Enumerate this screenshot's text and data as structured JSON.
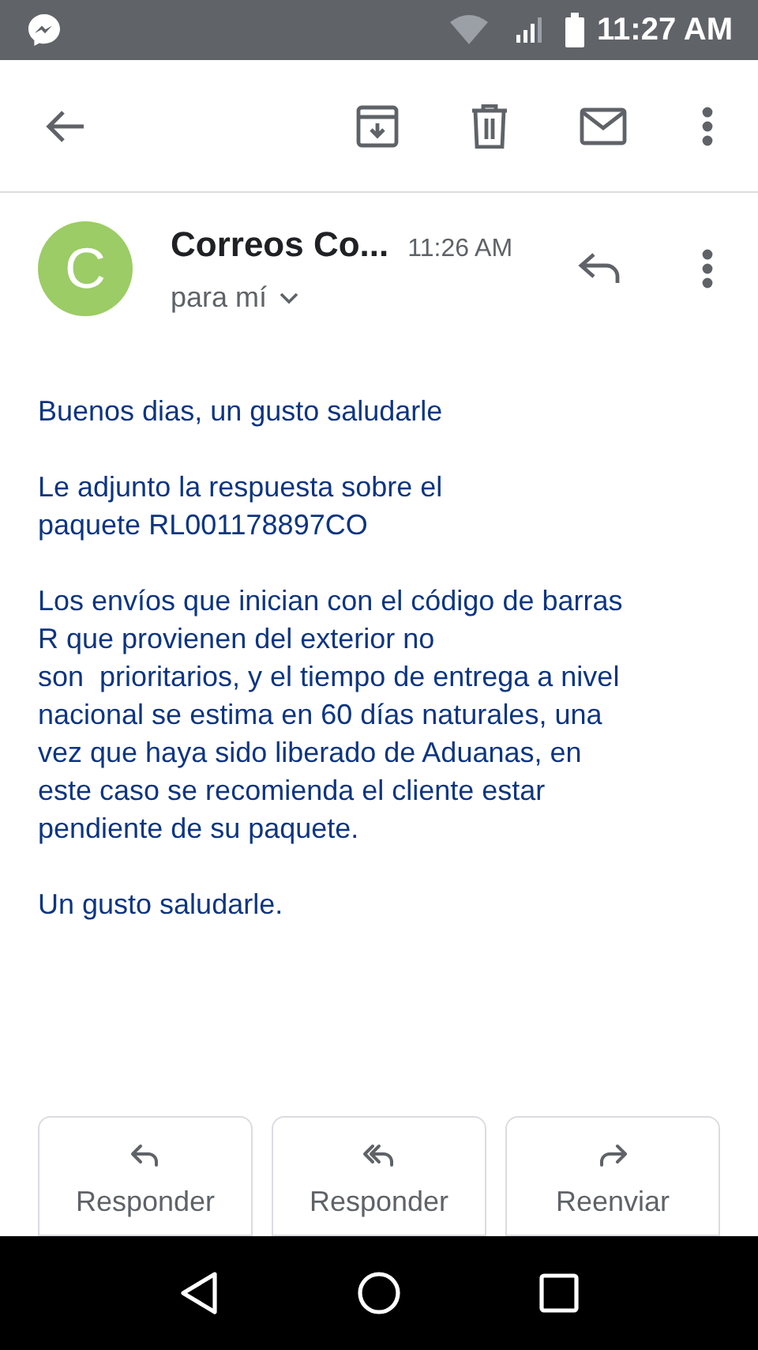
{
  "status_bar": {
    "time": "11:27 AM"
  },
  "email": {
    "avatar_letter": "C",
    "sender": "Correos Co...",
    "time": "11:26 AM",
    "recipient": "para mí",
    "paragraphs": [
      [
        "Buenos dias, un gusto saludarle"
      ],
      [
        "Le adjunto la respuesta sobre el",
        "paquete RL001178897CO"
      ],
      [
        "Los envíos que inician con el código de barras",
        "R que provienen del exterior no",
        "son  prioritarios, y el tiempo de entrega a nivel",
        "nacional se estima en 60 días naturales, una",
        "vez que haya sido liberado de Aduanas, en",
        "este caso se recomienda el cliente estar",
        "pendiente de su paquete."
      ],
      [
        "Un gusto saludarle."
      ]
    ]
  },
  "actions": [
    {
      "kind": "reply",
      "label": "Responder"
    },
    {
      "kind": "reply_all",
      "label": "Responder"
    },
    {
      "kind": "forward",
      "label": "Reenviar"
    }
  ]
}
